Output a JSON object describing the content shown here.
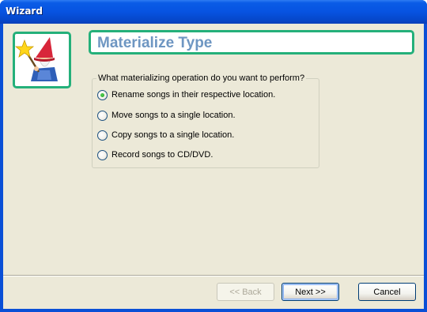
{
  "window": {
    "title": "Wizard"
  },
  "header": {
    "title": "Materialize Type",
    "icon": "wizard-icon"
  },
  "options": {
    "legend": "What materializing operation do you want to perform?",
    "items": [
      {
        "label": "Rename songs in their respective location.",
        "checked": true
      },
      {
        "label": "Move songs to a single location.",
        "checked": false
      },
      {
        "label": "Copy songs to a single location.",
        "checked": false
      },
      {
        "label": "Record songs to CD/DVD.",
        "checked": false
      }
    ]
  },
  "buttons": {
    "back": "<< Back",
    "next": "Next >>",
    "cancel": "Cancel"
  },
  "colors": {
    "accent_border": "#24b07a",
    "header_text": "#6e96c2",
    "titlebar": "#0753e1"
  }
}
